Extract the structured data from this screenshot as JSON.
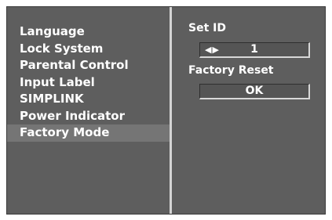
{
  "menu": {
    "items": [
      {
        "label": "Language"
      },
      {
        "label": "Lock System"
      },
      {
        "label": "Parental Control"
      },
      {
        "label": "Input Label"
      },
      {
        "label": "SIMPLINK"
      },
      {
        "label": "Power Indicator"
      },
      {
        "label": "Factory Mode"
      }
    ],
    "selected": "Factory Mode"
  },
  "settings": {
    "set_id": {
      "label": "Set ID",
      "arrows": "◀▶",
      "value": "1"
    },
    "factory_reset": {
      "label": "Factory Reset",
      "button_label": "OK"
    }
  },
  "colors": {
    "background": "#5e5e5e",
    "selected_row": "#757575",
    "divider": "#d4d4d4",
    "text": "#ffffff"
  }
}
